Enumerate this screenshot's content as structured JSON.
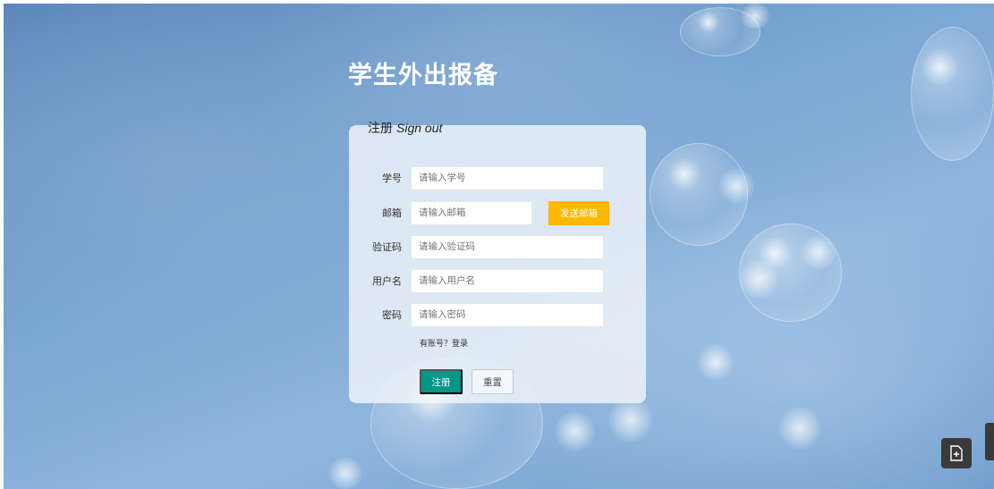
{
  "app": {
    "title": "学生外出报备"
  },
  "form": {
    "heading_cn": "注册",
    "heading_en": "Sign out",
    "fields": {
      "student_id": {
        "label": "学号",
        "placeholder": "请输入学号"
      },
      "email": {
        "label": "邮箱",
        "placeholder": "请输入邮箱"
      },
      "code": {
        "label": "验证码",
        "placeholder": "请输入验证码"
      },
      "username": {
        "label": "用户名",
        "placeholder": "请输入用户名"
      },
      "password": {
        "label": "密码",
        "placeholder": "请输入密码"
      }
    },
    "send_email_label": "发送邮箱",
    "login_hint": "有账号？登录",
    "register_label": "注册",
    "reset_label": "重置"
  },
  "icons": {
    "floating_action": "file-add-icon"
  },
  "colors": {
    "primary": "#009688",
    "warning": "#ffb800",
    "panel": "#eef3f8",
    "background": "#6f9ccb"
  }
}
